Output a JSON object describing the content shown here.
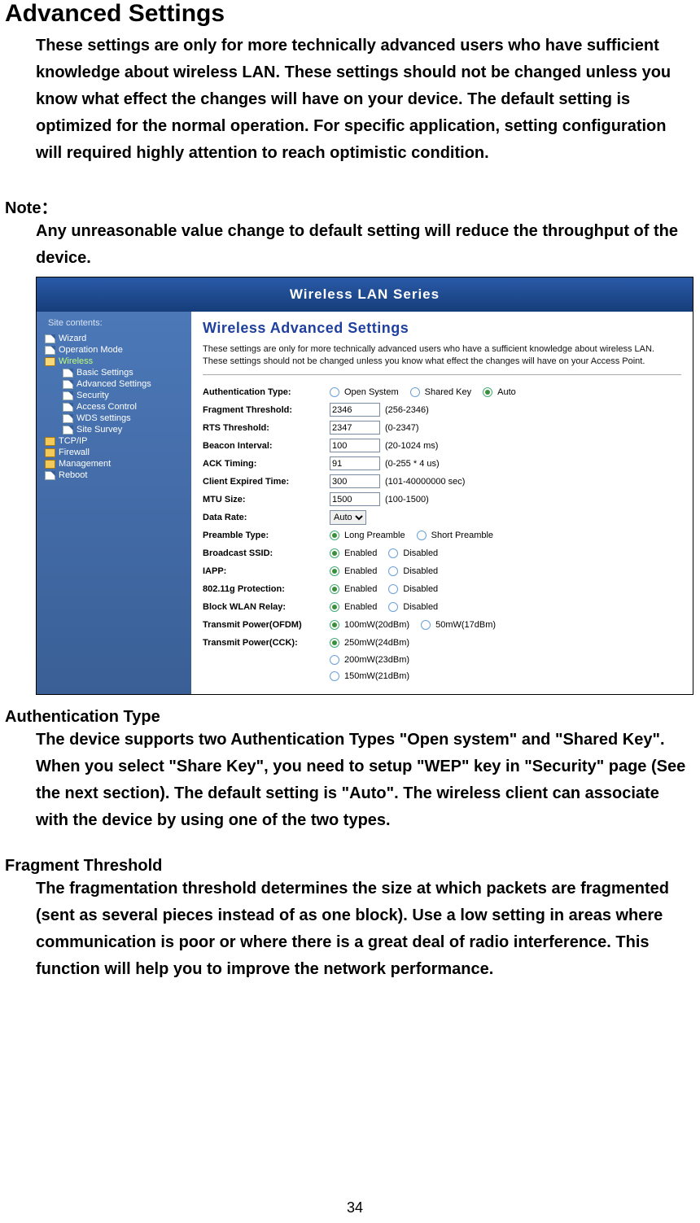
{
  "title": "Advanced Settings",
  "intro": "These settings are only for more technically advanced users who have sufficient knowledge about wireless LAN. These settings should not be changed unless you know what effect the changes will have on your device. The default setting is optimized for the normal operation. For specific application, setting configuration will required highly attention to reach optimistic condition.",
  "note_label": "Note：",
  "note_body": "Any unreasonable value change to default setting will reduce the throughput of the device.",
  "auth_heading": "Authentication Type",
  "auth_body": "The device supports two Authentication Types \"Open system\" and \"Shared Key\". When you select \"Share Key\", you need to setup \"WEP\" key in \"Security\" page (See the next section). The default setting is \"Auto\". The wireless client can associate with the device by using one of the two types.",
  "frag_heading": "Fragment Threshold",
  "frag_body": "The fragmentation threshold determines the size at which packets are fragmented (sent as several pieces instead of as one block). Use a low setting in areas where communication is poor or where there is a great deal of radio interference. This function will help you to improve the network performance.",
  "page_number": "34",
  "screenshot": {
    "banner": "Wireless LAN Series",
    "sidebar": {
      "heading": "Site contents:",
      "items": [
        {
          "label": "Wizard",
          "icon": "page",
          "level": 1
        },
        {
          "label": "Operation Mode",
          "icon": "page",
          "level": 1
        },
        {
          "label": "Wireless",
          "icon": "folder-open",
          "level": 1,
          "active": true
        },
        {
          "label": "Basic Settings",
          "icon": "page",
          "level": 2
        },
        {
          "label": "Advanced Settings",
          "icon": "page",
          "level": 2
        },
        {
          "label": "Security",
          "icon": "page",
          "level": 2
        },
        {
          "label": "Access Control",
          "icon": "page",
          "level": 2
        },
        {
          "label": "WDS settings",
          "icon": "page",
          "level": 2
        },
        {
          "label": "Site Survey",
          "icon": "page",
          "level": 2
        },
        {
          "label": "TCP/IP",
          "icon": "folder",
          "level": 1
        },
        {
          "label": "Firewall",
          "icon": "folder",
          "level": 1
        },
        {
          "label": "Management",
          "icon": "folder",
          "level": 1
        },
        {
          "label": "Reboot",
          "icon": "page",
          "level": 1
        }
      ]
    },
    "panel": {
      "title": "Wireless Advanced Settings",
      "desc": "These settings are only for more technically advanced users who have a sufficient knowledge about wireless LAN. These settings should not be changed unless you know what effect the changes will have on your Access Point.",
      "rows": {
        "auth": {
          "label": "Authentication Type:",
          "options": [
            "Open System",
            "Shared Key",
            "Auto"
          ],
          "selected": "Auto"
        },
        "frag": {
          "label": "Fragment Threshold:",
          "value": "2346",
          "range": "(256-2346)"
        },
        "rts": {
          "label": "RTS Threshold:",
          "value": "2347",
          "range": "(0-2347)"
        },
        "beacon": {
          "label": "Beacon Interval:",
          "value": "100",
          "range": "(20-1024 ms)"
        },
        "ack": {
          "label": "ACK Timing:",
          "value": "91",
          "range": "(0-255 * 4 us)"
        },
        "expired": {
          "label": "Client Expired Time:",
          "value": "300",
          "range": "(101-40000000 sec)"
        },
        "mtu": {
          "label": "MTU Size:",
          "value": "1500",
          "range": "(100-1500)"
        },
        "rate": {
          "label": "Data Rate:",
          "value": "Auto"
        },
        "preamble": {
          "label": "Preamble Type:",
          "options": [
            "Long Preamble",
            "Short Preamble"
          ],
          "selected": "Long Preamble"
        },
        "bssid": {
          "label": "Broadcast SSID:",
          "options": [
            "Enabled",
            "Disabled"
          ],
          "selected": "Enabled"
        },
        "iapp": {
          "label": "IAPP:",
          "options": [
            "Enabled",
            "Disabled"
          ],
          "selected": "Enabled"
        },
        "gprot": {
          "label": "802.11g Protection:",
          "options": [
            "Enabled",
            "Disabled"
          ],
          "selected": "Enabled"
        },
        "relay": {
          "label": "Block WLAN Relay:",
          "options": [
            "Enabled",
            "Disabled"
          ],
          "selected": "Enabled"
        },
        "ofdm": {
          "label": "Transmit Power(OFDM)",
          "options": [
            "100mW(20dBm)",
            "50mW(17dBm)"
          ],
          "selected": "100mW(20dBm)"
        },
        "cck": {
          "label": "Transmit Power(CCK):",
          "options": [
            "250mW(24dBm)",
            "200mW(23dBm)",
            "150mW(21dBm)"
          ],
          "selected": "250mW(24dBm)"
        }
      }
    }
  }
}
